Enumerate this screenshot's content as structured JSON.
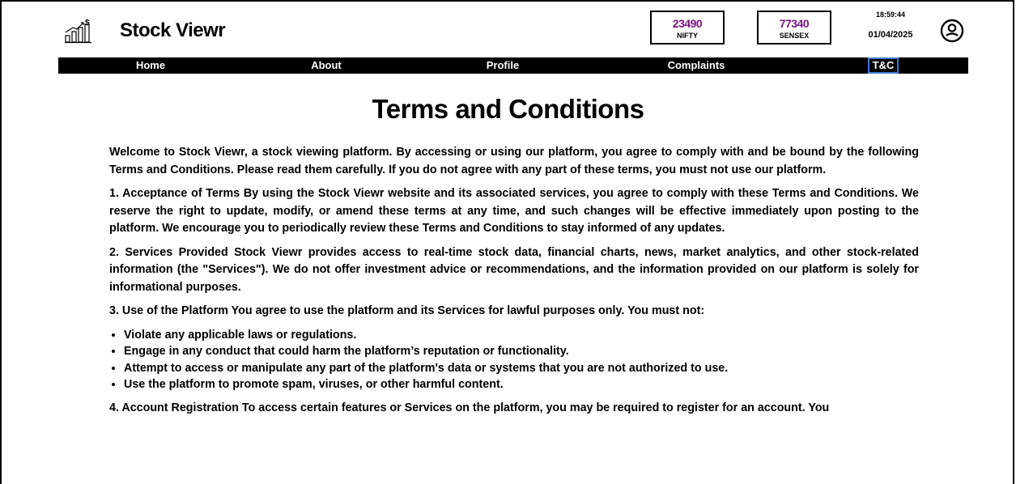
{
  "header": {
    "brand": "Stock Viewr",
    "logo_icon": "stock-chart-dollar-icon",
    "tickers": [
      {
        "value": "23490",
        "label": "NIFTY"
      },
      {
        "value": "77340",
        "label": "SENSEX"
      }
    ],
    "time": "18:59:44",
    "date": "01/04/2025",
    "user_icon": "user-circle-icon",
    "ticker_color": "#7a1480"
  },
  "nav": {
    "items": [
      {
        "label": "Home"
      },
      {
        "label": "About"
      },
      {
        "label": "Profile"
      },
      {
        "label": "Complaints"
      },
      {
        "label": "T&C"
      }
    ],
    "active": "T&C",
    "active_border_color": "#3a7bd5"
  },
  "page": {
    "title": "Terms and Conditions",
    "intro": "Welcome to Stock Viewr, a stock viewing platform. By accessing or using our platform, you agree to comply with and be bound by the following Terms and Conditions. Please read them carefully. If you do not agree with any part of these terms, you must not use our platform.",
    "section1": "1. Acceptance of Terms By using the Stock Viewr website and its associated services, you agree to comply with these Terms and Conditions. We reserve the right to update, modify, or amend these terms at any time, and such changes will be effective immediately upon posting to the platform. We encourage you to periodically review these Terms and Conditions to stay informed of any updates.",
    "section2": "2. Services Provided Stock Viewr provides access to real-time stock data, financial charts, news, market analytics, and other stock-related information (the \"Services\"). We do not offer investment advice or recommendations, and the information provided on our platform is solely for informational purposes.",
    "section3": "3. Use of the Platform You agree to use the platform and its Services for lawful purposes only. You must not:",
    "section3_items": [
      "Violate any applicable laws or regulations.",
      "Engage in any conduct that could harm the platform’s reputation or functionality.",
      "Attempt to access or manipulate any part of the platform's data or systems that you are not authorized to use.",
      "Use the platform to promote spam, viruses, or other harmful content."
    ],
    "section4": "4. Account Registration To access certain features or Services on the platform, you may be required to register for an account. You"
  }
}
